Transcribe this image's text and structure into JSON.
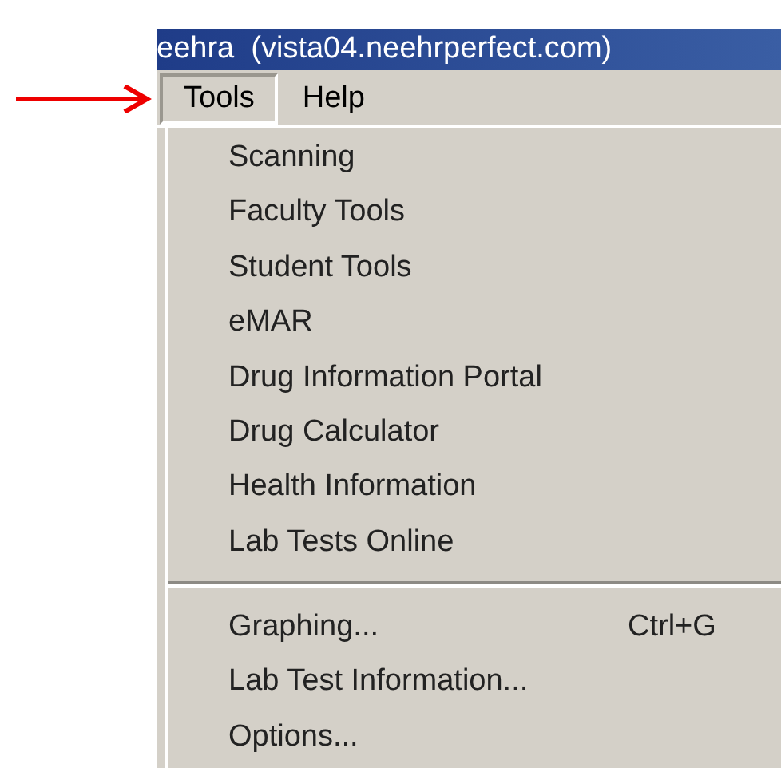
{
  "window": {
    "title": "eehra  (vista04.neehrperfect.com)"
  },
  "menubar": [
    {
      "label": "Tools",
      "selected": true
    },
    {
      "label": "Help",
      "selected": false
    }
  ],
  "menu": [
    {
      "kind": "item",
      "label": "Scanning"
    },
    {
      "kind": "item",
      "label": "Faculty Tools"
    },
    {
      "kind": "item",
      "label": "Student Tools"
    },
    {
      "kind": "item",
      "label": "eMAR"
    },
    {
      "kind": "item",
      "label": "Drug Information Portal"
    },
    {
      "kind": "item",
      "label": "Drug Calculator"
    },
    {
      "kind": "item",
      "label": "Health Information"
    },
    {
      "kind": "item",
      "label": "Lab Tests Online"
    },
    {
      "kind": "separator"
    },
    {
      "kind": "item",
      "label": "Graphing...",
      "shortcut": "Ctrl+G"
    },
    {
      "kind": "item",
      "label": "Lab Test Information..."
    },
    {
      "kind": "item",
      "label": "Options..."
    }
  ]
}
